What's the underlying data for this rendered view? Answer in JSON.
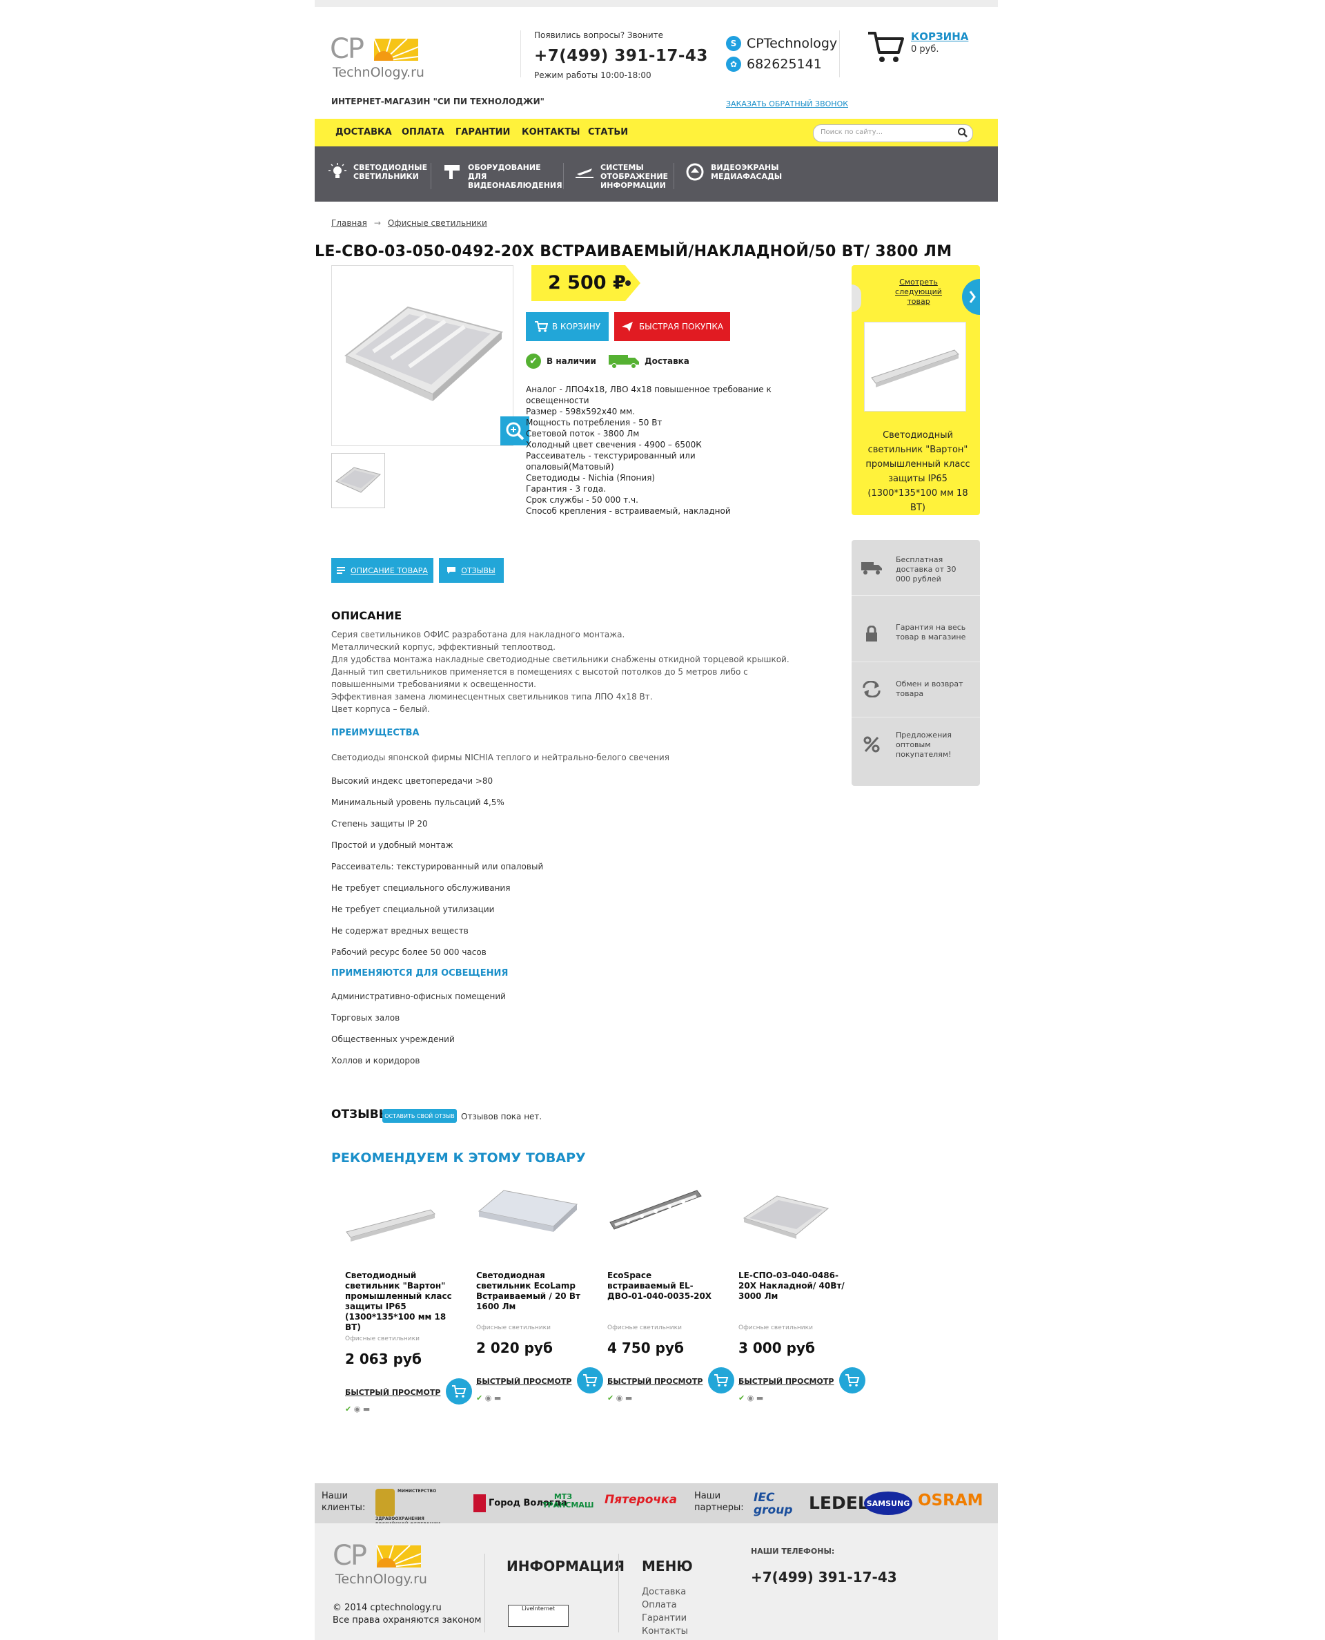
{
  "header": {
    "logo_cp": "CP",
    "logo_tech": "TechnOlogy.ru",
    "shop_name": "ИНТЕРНЕТ-МАГАЗИН \"СИ ПИ ТЕХНОЛОДЖИ\"",
    "questions": "Появились вопросы? Звоните",
    "phone": "+7(499) 391-17-43",
    "hours": "Режим работы 10:00-18:00",
    "skype": "CPTechnology",
    "icq": "682625141",
    "callback": "ЗАКАЗАТЬ ОБРАТНЫЙ ЗВОНОК",
    "cart_title": "КОРЗИНА",
    "cart_sum": "0 руб."
  },
  "nav": {
    "items": [
      "ДОСТАВКА",
      "ОПЛАТА",
      "ГАРАНТИИ",
      "КОНТАКТЫ",
      "СТАТЬИ"
    ],
    "search_placeholder": "Поиск по сайту..."
  },
  "categories": [
    {
      "label": "СВЕТОДИОДНЫЕ СВЕТИЛЬНИКИ",
      "icon": "bulb-icon"
    },
    {
      "label": "ОБОРУДОВАНИЕ ДЛЯ ВИДЕОНАБЛЮДЕНИЯ",
      "icon": "camera-icon"
    },
    {
      "label": "СИСТЕМЫ ОТОБРАЖЕНИЕ ИНФОРМАЦИИ",
      "icon": "plane-icon"
    },
    {
      "label": "ВИДЕОЭКРАНЫ МЕДИАФАСАДЫ",
      "icon": "globe-icon"
    }
  ],
  "breadcrumb": {
    "home": "Главная",
    "arrow": "→",
    "current": "Офисные светильники"
  },
  "product": {
    "title": "LE-СВО-03-050-0492-20Х ВСТРАИВАЕМЫЙ/НАКЛАДНОЙ/50 ВТ/ 3800 ЛМ",
    "price": "2 500 ₽",
    "add_to_cart": "В КОРЗИНУ",
    "quick_buy": "БЫСТРАЯ ПОКУПКА",
    "in_stock": "В наличии",
    "delivery": "Доставка",
    "specs": [
      "Аналог - ЛПО4х18, ЛВО 4х18 повышенное требование к освещенности",
      "Размер - 598х592х40 мм.",
      "Мощность потребления - 50 Вт",
      "Световой поток - 3800 Лм",
      "Холодный цвет свечения - 4900 – 6500К",
      "Рассеиватель - текстурированный или опаловый(Матовый)",
      "Светодиоды - Nichia (Япония)",
      "Гарантия - 3 года.",
      "Срок службы - 50 000 т.ч.",
      "Способ крепления - встраиваемый, накладной"
    ]
  },
  "next_product": {
    "link": "Смотреть следующий товар",
    "name": "Светодиодный светильник \"Вартон\" промышленный класс защиты IP65 (1300*135*100 мм 18 ВТ)"
  },
  "benefits": [
    {
      "text": "Бесплатная доставка от 30 000 рублей",
      "icon": "truck-icon"
    },
    {
      "text": "Гарантия на весь товар в магазине",
      "icon": "lock-icon"
    },
    {
      "text": "Обмен и возврат товара",
      "icon": "refresh-icon"
    },
    {
      "text": "Предложения оптовым покупателям!",
      "icon": "percent-icon"
    }
  ],
  "tabs": {
    "description": "ОПИСАНИЕ ТОВАРА",
    "reviews": "ОТЗЫВЫ"
  },
  "description": {
    "heading": "ОПИСАНИЕ",
    "lines": [
      "Серия светильников ОФИС разработана для накладного монтажа.",
      "Металлический корпус, эффективный теплоотвод.",
      "Для удобства монтажа накладные светодиодные светильники снабжены откидной торцевой крышкой.",
      "Данный тип светильников применяется в помещениях с высотой потолков до 5 метров либо с повышенными требованиями к освещенности.",
      "Эффективная замена люминесцентных светильников типа ЛПО 4х18 Вт.",
      "Цвет корпуса – белый."
    ],
    "advantages_heading": "ПРЕИМУЩЕСТВА",
    "advantages_intro": "Светодиоды японской фирмы NICHIA теплого и нейтрально-белого свечения",
    "advantages": [
      "Высокий индекс цветопередачи >80",
      "Минимальный уровень пульсаций 4,5%",
      "Степень защиты IP 20",
      "Простой и удобный монтаж",
      "Рассеиватель: текстурированный или опаловый",
      "Не требует специального обслуживания",
      "Не требует специальной утилизации",
      "Не содержат вредных веществ",
      "Рабочий ресурс более 50 000 часов"
    ],
    "usage_heading": "ПРИМЕНЯЮТСЯ ДЛЯ ОСВЕЩЕНИЯ",
    "usage": [
      "Административно-офисных помещений",
      "Торговых залов",
      "Общественных учреждений",
      "Холлов и коридоров"
    ]
  },
  "reviews": {
    "heading": "ОТЗЫВЫ",
    "button": "ОСТАВИТЬ СВОЙ ОТЗЫВ",
    "empty": "Отзывов пока нет."
  },
  "recommend": {
    "heading": "РЕКОМЕНДУЕМ К ЭТОМУ ТОВАРУ",
    "quick_view": "БЫСТРЫЙ ПРОСМОТР",
    "category": "Офисные светильники",
    "items": [
      {
        "name": "Светодиодный светильник \"Вартон\" промышленный класс защиты IP65 (1300*135*100 мм 18 ВТ)",
        "price": "2 063 руб"
      },
      {
        "name": "Светодиодная светильник EcoLamp Встраиваемый / 20 Вт 1600 Лм",
        "price": "2 020 руб"
      },
      {
        "name": "EcoSpace встраиваемый EL-ДВО-01-040-0035-20Х",
        "price": "4 750 руб"
      },
      {
        "name": "LE-СПО-03-040-0486-20Х Накладной/ 40Вт/ 3000 Лм",
        "price": "3 000 руб"
      }
    ]
  },
  "clients": {
    "clients_label": "Наши клиенты:",
    "partners_label": "Наши партнеры:",
    "client_logos": [
      "МИНИСТЕРСТВО ЗДРАВООХРАНЕНИЯ РОССИЙСКОЙ ФЕДЕРАЦИИ",
      "Город Вологда",
      "МТЗ ТРАНСМАШ",
      "Пятерочка"
    ],
    "partner_logos": [
      "IEC group",
      "LEDEL",
      "SAMSUNG",
      "OSRAM"
    ]
  },
  "footer": {
    "copyright": "© 2014 cptechnology.ru",
    "rights": "Все права охраняются законом",
    "info_heading": "ИНФОРМАЦИЯ",
    "menu_heading": "МЕНЮ",
    "menu": [
      "Доставка",
      "Оплата",
      "Гарантии",
      "Контакты"
    ],
    "counter": "LiveInternet",
    "phones_heading": "НАШИ ТЕЛЕФОНЫ:",
    "phone": "+7(499) 391-17-43"
  },
  "colors": {
    "accent_yellow": "#fff23b",
    "accent_blue": "#22a6d8",
    "buy_red": "#e11b22",
    "nav_gray": "#58585e"
  }
}
